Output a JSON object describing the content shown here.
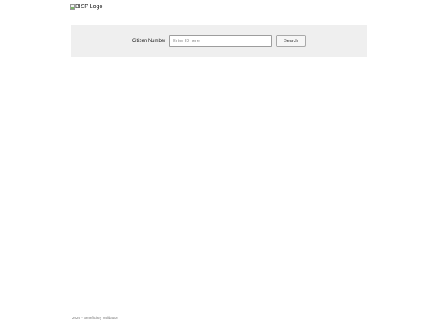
{
  "header": {
    "logo_alt": "BISP Logo",
    "logo_icon": "broken-image-icon"
  },
  "search": {
    "label": "Citizen Number",
    "placeholder": "Enter ID here",
    "value": "",
    "button_label": "Search"
  },
  "footer": {
    "text": "2026 - Beneficiary Validation"
  },
  "colors": {
    "search_band_bg": "#efefef",
    "page_bg": "#ffffff"
  }
}
